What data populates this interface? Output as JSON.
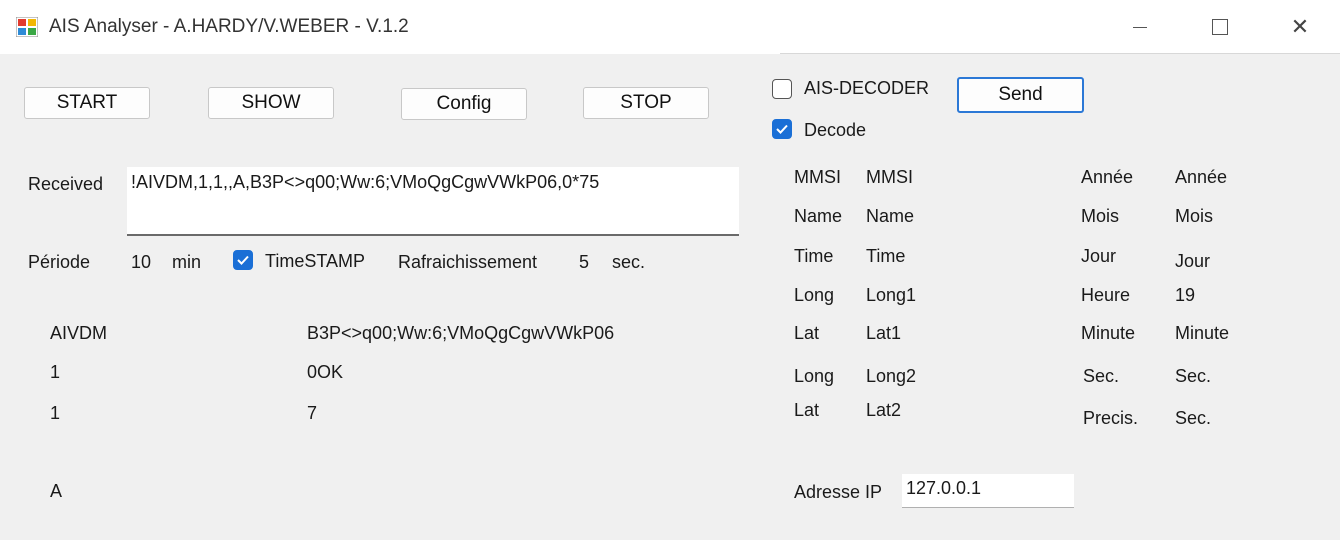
{
  "window": {
    "title": "AIS Analyser - A.HARDY/V.WEBER - V.1.2",
    "min_symbol": "",
    "close_symbol": "✕"
  },
  "toolbar": {
    "start": "START",
    "show": "SHOW",
    "config": "Config",
    "stop": "STOP"
  },
  "received": {
    "label": "Received",
    "value": "!AIVDM,1,1,,A,B3P<>q00;Ww:6;VMoQgCgwVWkP06,0*75"
  },
  "settings": {
    "periode_label": "Période",
    "periode_value": "10",
    "periode_unit": "min",
    "timestamp_label": "TimeSTAMP",
    "timestamp_checked": true,
    "refresh_label": "Rafraichissement",
    "refresh_value": "5",
    "refresh_unit": "sec."
  },
  "fields": {
    "left": [
      "AIVDM",
      "1",
      "1",
      "A"
    ],
    "right": [
      "B3P<>q00;Ww:6;VMoQgCgwVWkP06",
      "0OK",
      "7"
    ]
  },
  "decoder": {
    "ais_decoder_label": "AIS-DECODER",
    "ais_decoder_checked": false,
    "decode_label": "Decode",
    "decode_checked": true,
    "send_label": "Send"
  },
  "decoded": {
    "col1_labels": [
      "MMSI",
      "Name",
      "Time",
      "Long",
      "Lat",
      "Long",
      "Lat"
    ],
    "col1_values": [
      "MMSI",
      "Name",
      "Time",
      "Long1",
      "Lat1",
      "Long2",
      "Lat2"
    ],
    "col2_labels": [
      "Année",
      "Mois",
      "Jour",
      "Heure",
      "Minute",
      "Sec.",
      "Precis."
    ],
    "col2_values": [
      "Année",
      "Mois",
      "Jour",
      "19",
      "Minute",
      "Sec.",
      "Sec."
    ]
  },
  "network": {
    "ip_label": "Adresse IP",
    "ip_value": "127.0.0.1"
  }
}
